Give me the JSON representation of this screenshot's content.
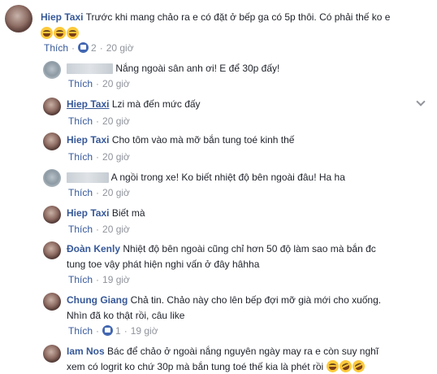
{
  "comments": [
    {
      "author": "Hiep Taxi",
      "text": "Trước khi mang chảo ra e có đặt ở bếp ga có 5p thôi. Có phải thế ko e",
      "like_label": "Thích",
      "like_count": "2",
      "time": "20 giờ",
      "emojis": [
        "grinning-sweat-emoji",
        "grinning-sweat-emoji",
        "grinning-sweat-emoji"
      ]
    }
  ],
  "replies": [
    {
      "author": "",
      "redacted": true,
      "text": "Nắng ngoài sân anh ơi! E để 30p đấy!",
      "like_label": "Thích",
      "time": "20 giờ"
    },
    {
      "author": "Hiep Taxi",
      "text": "Lzi mà đến mức đấy",
      "like_label": "Thích",
      "time": "20 giờ"
    },
    {
      "author": "Hiep Taxi",
      "text": "Cho tôm vào mà mỡ bắn tung toé kinh thế",
      "like_label": "Thích",
      "time": "20 giờ"
    },
    {
      "author": "",
      "redacted": true,
      "text": "A ngồi trong xe! Ko biết nhiệt độ bên ngoài đâu! Ha ha",
      "like_label": "Thích",
      "time": "20 giờ"
    },
    {
      "author": "Hiep Taxi",
      "text": "Biết mà",
      "like_label": "Thích",
      "time": "20 giờ"
    },
    {
      "author": "Đoàn Kenly",
      "text": "Nhiệt độ bên ngoài cũng chỉ hơn 50 độ làm sao mà bắn đc",
      "text2": "tung toe vậy phát hiện nghi vấn ở đây hâhha",
      "like_label": "Thích",
      "time": "19 giờ"
    },
    {
      "author": "Chung Giang",
      "text": "Chả tin. Chảo này cho lên bếp đợi mỡ già mới cho xuống.",
      "text2": "Nhìn đã ko thật rồi, câu like",
      "like_label": "Thích",
      "like_count": "1",
      "time": "19 giờ"
    },
    {
      "author": "Iam Nos",
      "text": "Bác để chảo ở ngoài nắng nguyên ngày may ra e còn suy nghĩ",
      "text2": "xem có logrit ko chứ 30p mà bắn tung toé thế kia là phét rồi"
    }
  ],
  "menu_icon": "chevron-down-icon"
}
